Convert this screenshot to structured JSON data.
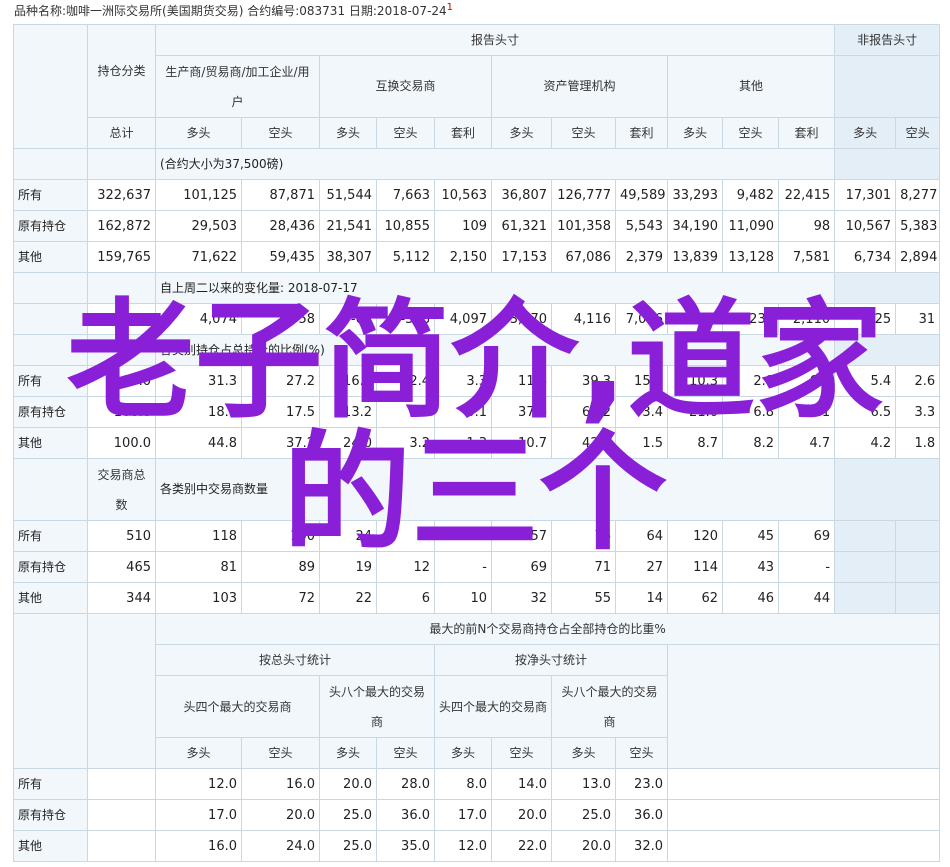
{
  "header": {
    "text": "品种名称:咖啡一洲际交易所(美国期货交易)   合约编号:083731   日期:2018-07-24",
    "mark": "1"
  },
  "table": {
    "reported_header": "报告头寸",
    "nonreported_header": "非报告头寸",
    "position_category": "持仓分类",
    "groups": [
      "生产商/贸易商/加工企业/用户",
      "互换交易商",
      "资产管理机构",
      "其他"
    ],
    "total": "总计",
    "long": "多头",
    "short": "空头",
    "spread": "套利",
    "s1": "(合约大小为37,500磅)",
    "s2": "自上周二以来的变化量: 2018-07-17",
    "s3": "各类别持仓占总持仓的比例(%)",
    "s4_left": "交易商总数",
    "s4": "各类别中交易商数量",
    "s5": "最大的前N个交易商持仓占全部持仓的比重%",
    "gross": "按总头寸统计",
    "net": "按净头寸统计",
    "top4": "头四个最大的交易商",
    "top8": "头八个最大的交易商",
    "rows1": [
      {
        "label": "所有",
        "v": [
          "322,637",
          "101,125",
          "87,871",
          "51,544",
          "7,663",
          "10,563",
          "36,807",
          "126,777",
          "49,589",
          "33,293",
          "9,482",
          "22,415",
          "17,301",
          "8,277"
        ]
      },
      {
        "label": "原有持仓",
        "v": [
          "162,872",
          "29,503",
          "28,436",
          "21,541",
          "10,855",
          "109",
          "61,321",
          "101,358",
          "5,543",
          "34,190",
          "11,090",
          "98",
          "10,567",
          "5,383"
        ]
      },
      {
        "label": "其他",
        "v": [
          "159,765",
          "71,622",
          "59,435",
          "38,307",
          "5,112",
          "2,150",
          "17,153",
          "67,086",
          "2,379",
          "13,839",
          "13,128",
          "7,581",
          "6,734",
          "2,894"
        ]
      }
    ],
    "change_row": [
      "19,847",
      "4,074",
      "2,558",
      "-60",
      "-308",
      "4,097",
      "3,970",
      "4,116",
      "7,006",
      "-1,775",
      "237",
      "2,110",
      "425",
      "31"
    ],
    "rows3": [
      {
        "label": "所有",
        "v": [
          "100.0",
          "31.3",
          "27.2",
          "16.0",
          "2.4",
          "3.3",
          "11.4",
          "39.3",
          "15.4",
          "10.3",
          "2.9",
          "6.9",
          "5.4",
          "2.6"
        ]
      },
      {
        "label": "原有持仓",
        "v": [
          "100.0",
          "18.1",
          "17.5",
          "13.2",
          "6.7",
          "0.1",
          "37.6",
          "62.2",
          "3.4",
          "21.0",
          "6.8",
          "0.1",
          "6.5",
          "3.3"
        ]
      },
      {
        "label": "其他",
        "v": [
          "100.0",
          "44.8",
          "37.2",
          "24.0",
          "3.2",
          "1.3",
          "10.7",
          "42.0",
          "1.5",
          "8.7",
          "8.2",
          "4.7",
          "4.2",
          "1.8"
        ]
      }
    ],
    "rows4": [
      {
        "label": "所有",
        "v": [
          "510",
          "118",
          "100",
          "24",
          "7",
          "17",
          "57",
          "76",
          "64",
          "120",
          "45",
          "69"
        ]
      },
      {
        "label": "原有持仓",
        "v": [
          "465",
          "81",
          "89",
          "19",
          "12",
          "-",
          "69",
          "71",
          "27",
          "114",
          "43",
          "-"
        ]
      },
      {
        "label": "其他",
        "v": [
          "344",
          "103",
          "72",
          "22",
          "6",
          "10",
          "32",
          "55",
          "14",
          "62",
          "46",
          "44"
        ]
      }
    ],
    "rows5": [
      {
        "label": "所有",
        "v": [
          "12.0",
          "16.0",
          "20.0",
          "28.0",
          "8.0",
          "14.0",
          "13.0",
          "23.0"
        ]
      },
      {
        "label": "原有持仓",
        "v": [
          "17.0",
          "20.0",
          "25.0",
          "36.0",
          "17.0",
          "20.0",
          "25.0",
          "36.0"
        ]
      },
      {
        "label": "其他",
        "v": [
          "16.0",
          "24.0",
          "25.0",
          "35.0",
          "12.0",
          "22.0",
          "20.0",
          "32.0"
        ]
      }
    ]
  },
  "overlay": {
    "line1": "老子简介,道家",
    "line2": "的三个"
  },
  "colors": {
    "border": "#c9d9e4",
    "header_bg": "#f2f7fb",
    "overlay": "#8a1fd8"
  }
}
